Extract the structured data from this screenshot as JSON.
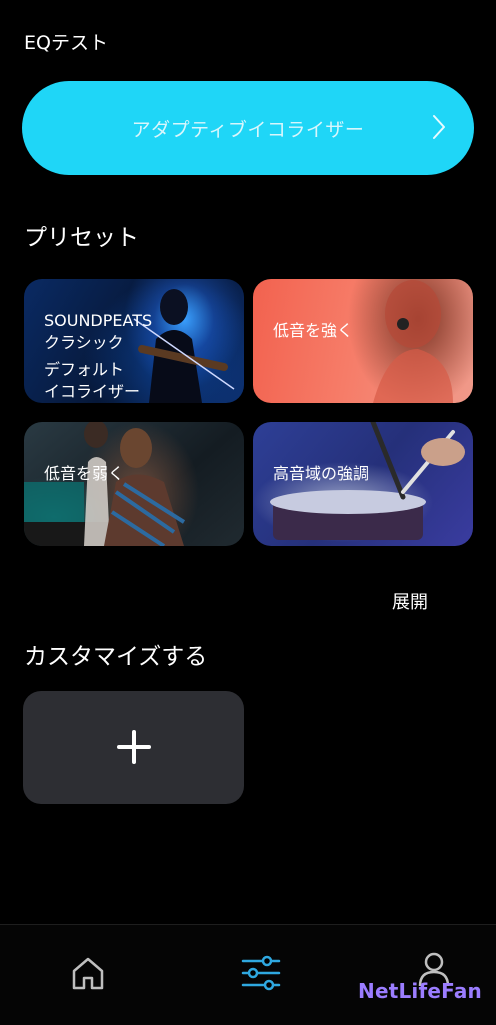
{
  "header": {
    "title": "EQテスト"
  },
  "adaptive": {
    "label": "アダプティブイコライザー"
  },
  "presets": {
    "section_title": "プリセット",
    "cards": [
      {
        "brand": "SOUNDPEATS",
        "name": "クラシック",
        "sub1": "デフォルト",
        "sub2": "イコライザー"
      },
      {
        "name": "低音を強く"
      },
      {
        "name": "低音を弱く"
      },
      {
        "name": "高音域の強調"
      }
    ],
    "expand_label": "展開"
  },
  "custom": {
    "section_title": "カスタマイズする"
  },
  "nav": {
    "items": [
      "home-icon",
      "equalizer-icon",
      "profile-icon"
    ],
    "active_color": "#2fa8e0",
    "inactive_color": "#bfbfbf"
  },
  "watermark": "NetLifeFan",
  "colors": {
    "accent": "#1fd6f7"
  }
}
